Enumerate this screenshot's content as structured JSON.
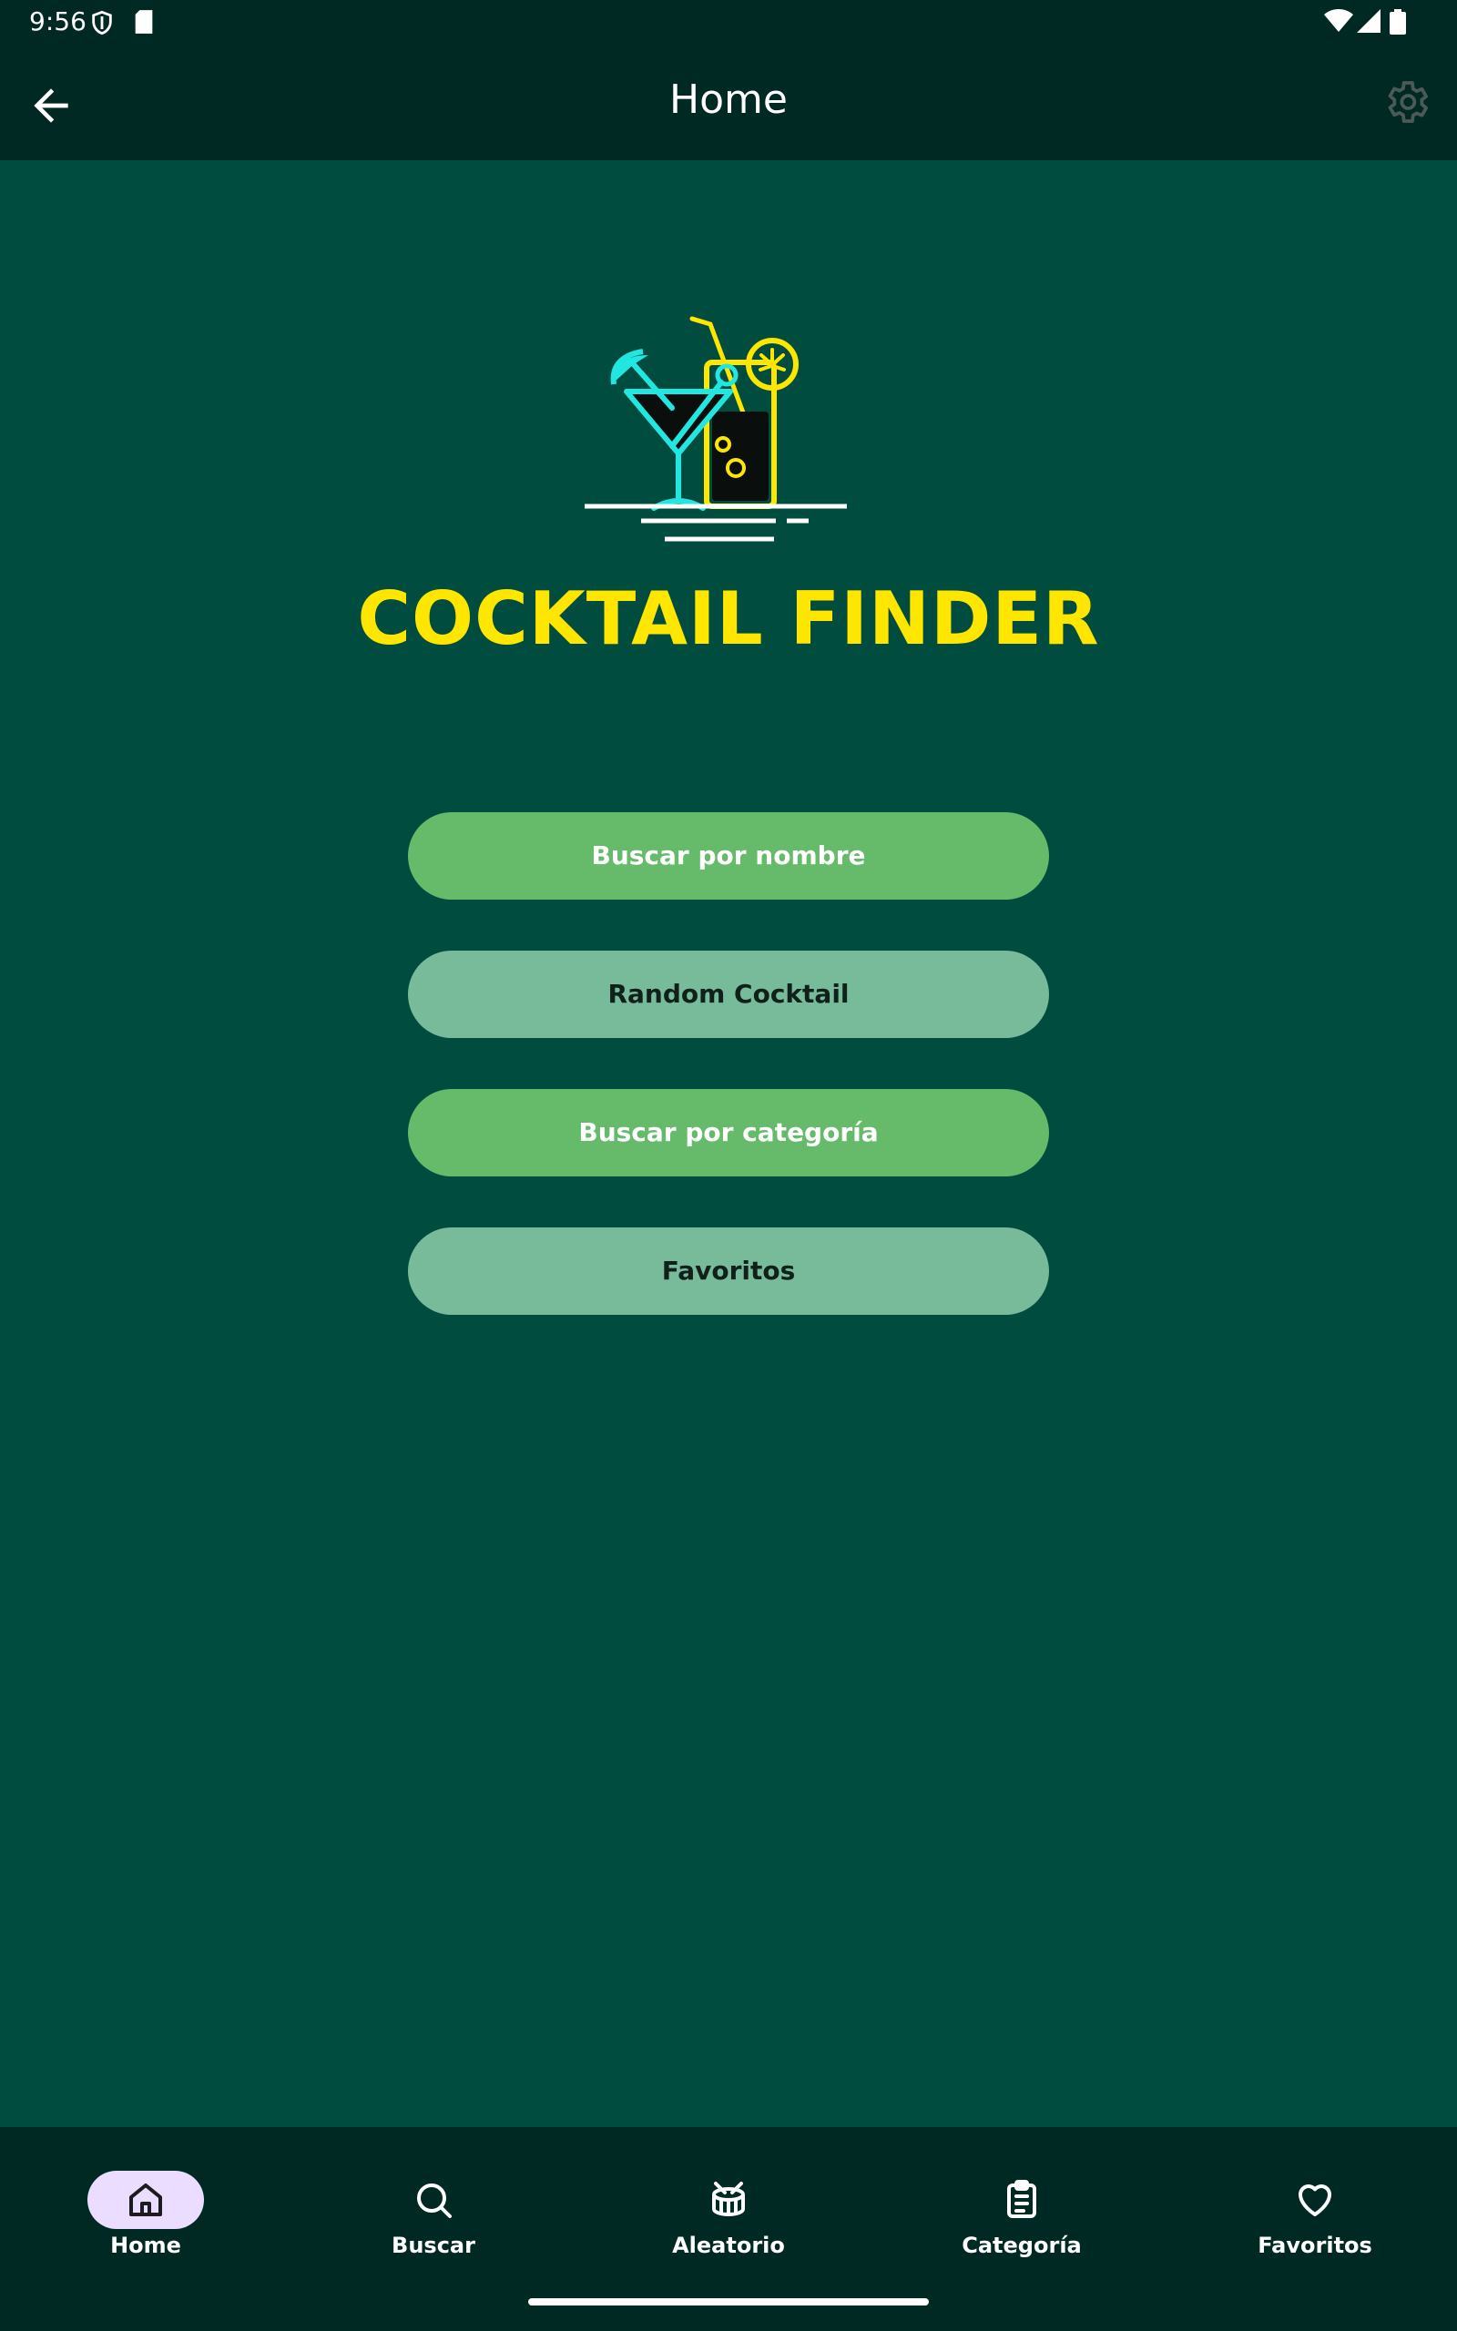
{
  "status_bar": {
    "time": "9:56",
    "icons": [
      "shield-icon",
      "sd-card-icon",
      "wifi-icon",
      "signal-icon",
      "battery-icon"
    ]
  },
  "app_bar": {
    "title": "Home",
    "back_icon": "arrow-back-icon",
    "settings_icon": "gear-icon"
  },
  "brand": {
    "logo_icon": "cocktail-logo-icon",
    "title": "COCKTAIL FINDER"
  },
  "menu": {
    "buttons": [
      {
        "label": "Buscar por nombre",
        "style": "primary"
      },
      {
        "label": "Random Cocktail",
        "style": "secondary"
      },
      {
        "label": "Buscar por categoría",
        "style": "primary"
      },
      {
        "label": "Favoritos",
        "style": "secondary"
      }
    ]
  },
  "bottom_nav": {
    "items": [
      {
        "label": "Home",
        "icon": "home-icon",
        "active": true
      },
      {
        "label": "Buscar",
        "icon": "search-icon",
        "active": false
      },
      {
        "label": "Aleatorio",
        "icon": "drum-icon",
        "active": false
      },
      {
        "label": "Categoría",
        "icon": "clipboard-list-icon",
        "active": false
      },
      {
        "label": "Favoritos",
        "icon": "heart-icon",
        "active": false
      }
    ]
  },
  "colors": {
    "background": "#004d40",
    "bars": "#002924",
    "brand_yellow": "#ffe600",
    "logo_cyan": "#22e6e0",
    "button_primary": "#66bb6a",
    "button_secondary": "#77bb9b",
    "nav_active_pill": "#eaddff"
  }
}
